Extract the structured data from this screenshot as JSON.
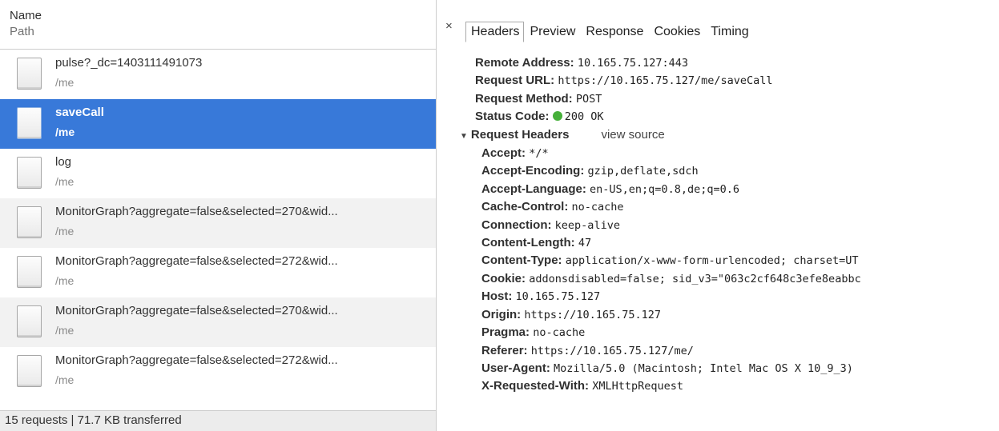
{
  "list": {
    "header": {
      "name": "Name",
      "path": "Path"
    },
    "rows": [
      {
        "name": "pulse?_dc=1403111491073",
        "path": "/me"
      },
      {
        "name": "saveCall",
        "path": "/me"
      },
      {
        "name": "log",
        "path": "/me"
      },
      {
        "name": "MonitorGraph?aggregate=false&selected=270&wid...",
        "path": "/me"
      },
      {
        "name": "MonitorGraph?aggregate=false&selected=272&wid...",
        "path": "/me"
      },
      {
        "name": "MonitorGraph?aggregate=false&selected=270&wid...",
        "path": "/me"
      },
      {
        "name": "MonitorGraph?aggregate=false&selected=272&wid...",
        "path": "/me"
      }
    ],
    "status": "15 requests | 71.7 KB transferred"
  },
  "panel": {
    "close": "×",
    "tabs": [
      "Headers",
      "Preview",
      "Response",
      "Cookies",
      "Timing"
    ],
    "general": [
      {
        "key": "Remote Address:",
        "value": "10.165.75.127:443"
      },
      {
        "key": "Request URL:",
        "value": "https://10.165.75.127/me/saveCall"
      },
      {
        "key": "Request Method:",
        "value": "POST"
      },
      {
        "key": "Status Code:",
        "value": "200 OK"
      }
    ],
    "section": {
      "triangle": "▼",
      "title": "Request Headers",
      "view_source": "view source"
    },
    "request_headers": [
      {
        "key": "Accept:",
        "value": "*/*"
      },
      {
        "key": "Accept-Encoding:",
        "value": "gzip,deflate,sdch"
      },
      {
        "key": "Accept-Language:",
        "value": "en-US,en;q=0.8,de;q=0.6"
      },
      {
        "key": "Cache-Control:",
        "value": "no-cache"
      },
      {
        "key": "Connection:",
        "value": "keep-alive"
      },
      {
        "key": "Content-Length:",
        "value": "47"
      },
      {
        "key": "Content-Type:",
        "value": "application/x-www-form-urlencoded; charset=UT"
      },
      {
        "key": "Cookie:",
        "value": "addonsdisabled=false; sid_v3=\"063c2cf648c3efe8eabbc"
      },
      {
        "key": "Host:",
        "value": "10.165.75.127"
      },
      {
        "key": "Origin:",
        "value": "https://10.165.75.127"
      },
      {
        "key": "Pragma:",
        "value": "no-cache"
      },
      {
        "key": "Referer:",
        "value": "https://10.165.75.127/me/"
      },
      {
        "key": "User-Agent:",
        "value": "Mozilla/5.0 (Macintosh; Intel Mac OS X 10_9_3)"
      },
      {
        "key": "X-Requested-With:",
        "value": "XMLHttpRequest"
      }
    ],
    "status_color": "#46b03a"
  },
  "colors": {
    "selected_row": "#3879d9",
    "alt_row": "#f2f2f2"
  }
}
